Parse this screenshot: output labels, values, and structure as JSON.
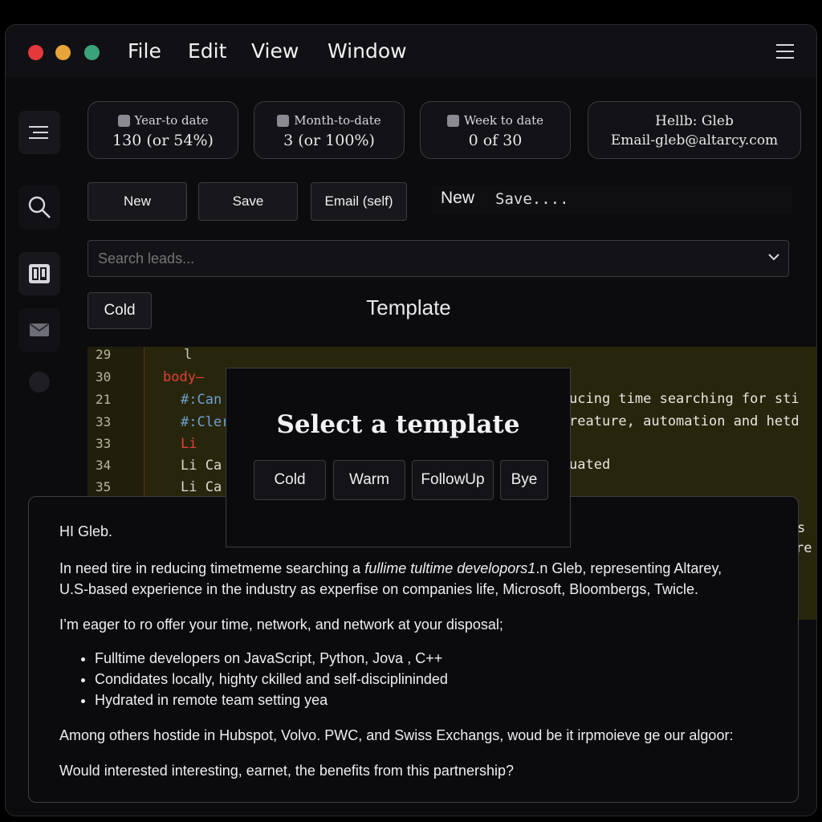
{
  "window": {
    "menu": [
      "File",
      "Edit",
      "View",
      "Window"
    ]
  },
  "stats": [
    {
      "label": "Year-to date",
      "value": "130 (or 54%)"
    },
    {
      "label": "Month-to-date",
      "value": "3 (or 100%)"
    },
    {
      "label": "Week to date",
      "value": "0 of 30"
    }
  ],
  "user": {
    "greeting": "Hellb: Gleb",
    "email": "Email-gleb@altarcy.com"
  },
  "toolbar": {
    "new_label": "New",
    "save_label": "Save",
    "email_label": "Email (self)",
    "status_new": "New",
    "status_save": "Save....",
    "filter_label": "Cold"
  },
  "search": {
    "placeholder": "Search leads..."
  },
  "template_heading": "Template",
  "code": {
    "lines": [
      {
        "num": "29",
        "text": "l"
      },
      {
        "num": "30",
        "text": "body—"
      },
      {
        "num": "21",
        "text": "#:Can"
      },
      {
        "num": "33",
        "text": "#:Cler"
      },
      {
        "num": "33",
        "text": "Li"
      },
      {
        "num": "34",
        "text": "Li Ca"
      },
      {
        "num": "35",
        "text": "Li Ca"
      }
    ],
    "right_text": [
      "ucing time searching for sti",
      "reature, automation and hetd",
      "uated"
    ],
    "edge_text": [
      "s",
      "re"
    ]
  },
  "modal": {
    "title": "Select a template",
    "options": [
      "Cold",
      "Warm",
      "FollowUp",
      "Bye"
    ]
  },
  "email": {
    "greeting": "HI Gleb.",
    "para1_a": "In need tire in reducing timetmeme searching a ",
    "para1_em": "fullime tultime developors1",
    "para1_b": ".n Gleb, representing Altarey,",
    "para1_c": "U.S-based experience in the industry as experfise on companies life, Microsoft, Bloombergs, Twicle.",
    "para2": "I’m eager to ro offer your time, network, and network at your disposal;",
    "bullets": [
      "Fulltime developers on JavaScript, Python, Jova , C++",
      "Condidates locally, highty ckilled and self-disciplininded",
      "Hydrated in remote team setting yea"
    ],
    "para3": "Among others hostide in Hubspot, Volvo. PWC, and Swiss Exchangs, woud be it irpmoieve ge our algoor:",
    "para4": "Would interested interesting, earnet, the benefits from this partnership?"
  }
}
